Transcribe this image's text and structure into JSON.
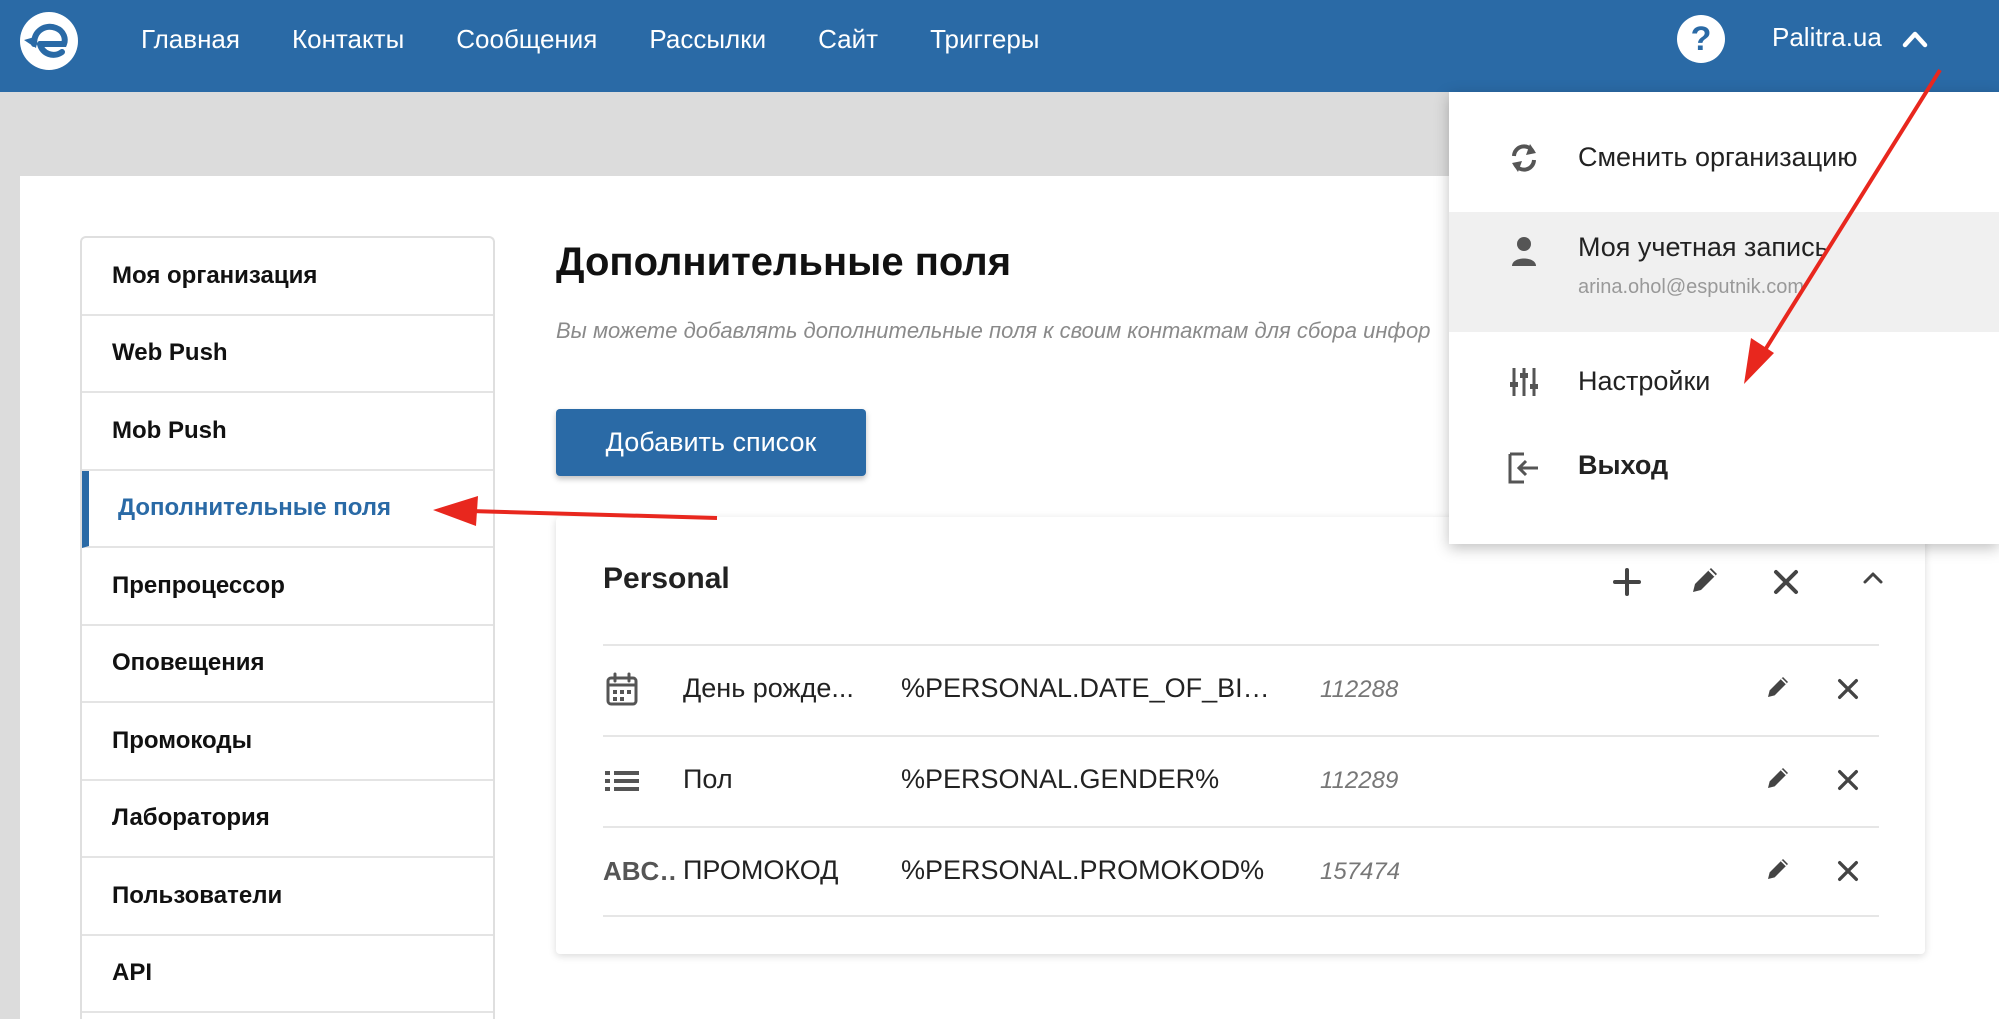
{
  "colors": {
    "brand": "#2a6aa6",
    "annotation_arrow": "#e8271e"
  },
  "topbar": {
    "nav": [
      "Главная",
      "Контакты",
      "Сообщения",
      "Рассылки",
      "Сайт",
      "Триггеры"
    ],
    "help_label": "?",
    "account_name": "Palitra.ua"
  },
  "sidebar": {
    "items": [
      "Моя организация",
      "Web Push",
      "Mob Push",
      "Дополнительные поля",
      "Препроцессор",
      "Оповещения",
      "Промокоды",
      "Лаборатория",
      "Пользователи",
      "API"
    ],
    "active_index": 3
  },
  "main": {
    "title": "Дополнительные поля",
    "description": "Вы можете добавлять дополнительные поля к своим контактам для сбора инфор",
    "add_button": "Добавить список"
  },
  "panel": {
    "title": "Personal",
    "rows": [
      {
        "type_icon": "calendar-icon",
        "type_text": "",
        "name": "День рожде...",
        "variable": "%PERSONAL.DATE_OF_BIRT...",
        "id": "112288"
      },
      {
        "type_icon": "list-icon",
        "type_text": "",
        "name": "Пол",
        "variable": "%PERSONAL.GENDER%",
        "id": "112289"
      },
      {
        "type_icon": "text-type-icon",
        "type_text": "ABC…",
        "name": "ПРОМОКОД",
        "variable": "%PERSONAL.PROMOKOD%",
        "id": "157474"
      }
    ]
  },
  "dropdown": {
    "switch_org": "Сменить организацию",
    "my_account": "Моя учетная запись",
    "my_account_email": "arina.ohol@esputnik.com",
    "settings": "Настройки",
    "logout": "Выход"
  }
}
